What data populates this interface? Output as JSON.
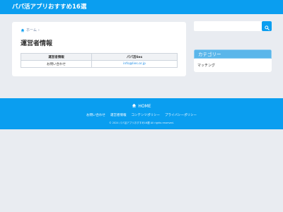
{
  "header": {
    "site_title": "パパ活アプリおすすめ16選"
  },
  "breadcrumb": {
    "home_label": "ホーム",
    "separator": "›"
  },
  "page": {
    "title": "運営者情報",
    "table": {
      "headers": [
        "運営者情報",
        "パパ活lies"
      ],
      "rows": [
        [
          "お問い合わせ",
          "info@lies.or.jp"
        ]
      ]
    }
  },
  "sidebar": {
    "search": {
      "placeholder": ""
    },
    "category": {
      "title": "カテゴリー",
      "items": [
        "マッチング"
      ]
    }
  },
  "footer": {
    "home_label": "HOME",
    "links": [
      "お問い合わせ",
      "運営者情報",
      "コンテンツポリシー",
      "プライバシーポリシー"
    ],
    "copyright": "© 2024 パパ活アプリおすすめ16選 All rights reserved."
  },
  "icons": {
    "home": "home-icon",
    "search": "search-icon"
  },
  "colors": {
    "accent": "#0a9ef0",
    "category_header": "#5ab6ea",
    "link": "#1f8ce6",
    "background": "#e9ecf1"
  }
}
